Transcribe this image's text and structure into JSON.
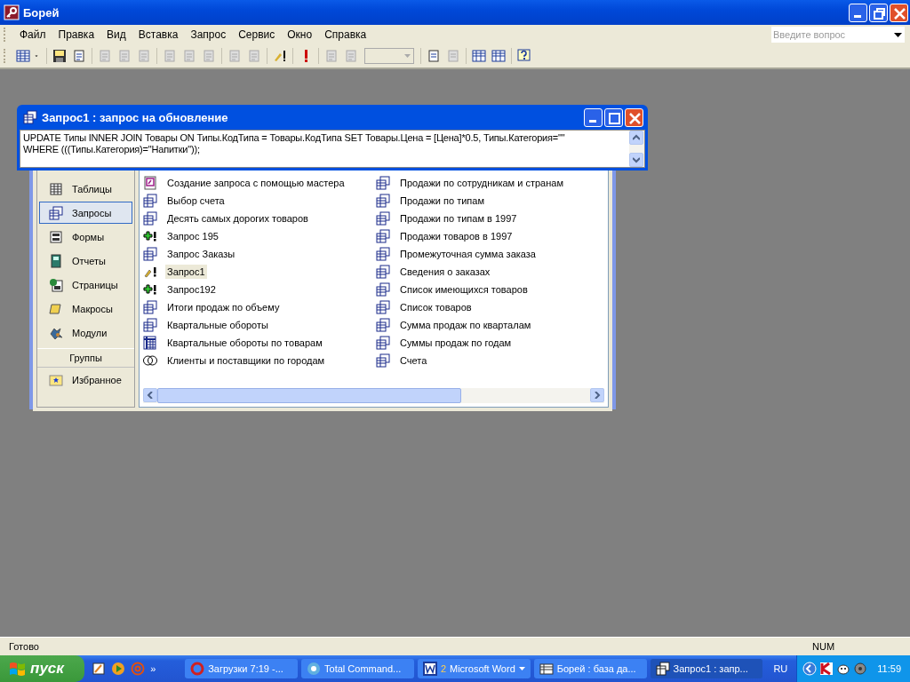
{
  "app": {
    "title": "Борей",
    "menu": [
      "Файл",
      "Правка",
      "Вид",
      "Вставка",
      "Запрос",
      "Сервис",
      "Окно",
      "Справка"
    ],
    "help_placeholder": "Введите вопрос"
  },
  "query_window": {
    "title": "Запрос1 : запрос на обновление",
    "sql": "UPDATE Типы INNER JOIN Товары ON Типы.КодТипа = Товары.КодТипа SET Товары.Цена = [Цена]*0.5, Типы.Категория=\"\" WHERE (((Типы.Категория)=\"Напитки\"));"
  },
  "db_window": {
    "objects": [
      {
        "label": "Таблицы",
        "kind": "table",
        "selected": false
      },
      {
        "label": "Запросы",
        "kind": "query",
        "selected": true
      },
      {
        "label": "Формы",
        "kind": "form",
        "selected": false
      },
      {
        "label": "Отчеты",
        "kind": "report",
        "selected": false
      },
      {
        "label": "Страницы",
        "kind": "page",
        "selected": false
      },
      {
        "label": "Макросы",
        "kind": "macro",
        "selected": false
      },
      {
        "label": "Модули",
        "kind": "module",
        "selected": false
      }
    ],
    "groups_header": "Группы",
    "groups": [
      {
        "label": "Избранное",
        "kind": "favorites",
        "selected": false
      }
    ],
    "items": [
      {
        "label": "Создание запроса с помощью мастера",
        "kind": "wizard",
        "selected": false
      },
      {
        "label": "Выбор счета",
        "kind": "select",
        "selected": false
      },
      {
        "label": "Десять самых дорогих товаров",
        "kind": "select",
        "selected": false
      },
      {
        "label": "Запрос 195",
        "kind": "append",
        "selected": false
      },
      {
        "label": "Запрос Заказы",
        "kind": "select",
        "selected": false
      },
      {
        "label": "Запрос1",
        "kind": "update",
        "selected": true
      },
      {
        "label": "Запрос192",
        "kind": "append",
        "selected": false
      },
      {
        "label": "Итоги продаж по объему",
        "kind": "select",
        "selected": false
      },
      {
        "label": "Квартальные обороты",
        "kind": "select",
        "selected": false
      },
      {
        "label": "Квартальные обороты по товарам",
        "kind": "crosstab",
        "selected": false
      },
      {
        "label": "Клиенты и поставщики по городам",
        "kind": "union",
        "selected": false
      },
      {
        "label": "Продажи по сотрудникам и странам",
        "kind": "select",
        "selected": false
      },
      {
        "label": "Продажи по типам",
        "kind": "select",
        "selected": false
      },
      {
        "label": "Продажи по типам в 1997",
        "kind": "select",
        "selected": false
      },
      {
        "label": "Продажи товаров в 1997",
        "kind": "select",
        "selected": false
      },
      {
        "label": "Промежуточная сумма заказа",
        "kind": "select",
        "selected": false
      },
      {
        "label": "Сведения о заказах",
        "kind": "select",
        "selected": false
      },
      {
        "label": "Список имеющихся товаров",
        "kind": "select",
        "selected": false
      },
      {
        "label": "Список товаров",
        "kind": "select",
        "selected": false
      },
      {
        "label": "Сумма продаж по кварталам",
        "kind": "select",
        "selected": false
      },
      {
        "label": "Суммы продаж по годам",
        "kind": "select",
        "selected": false
      },
      {
        "label": "Счета",
        "kind": "select",
        "selected": false
      }
    ]
  },
  "status_bar": {
    "text": "Готово",
    "num": "NUM"
  },
  "taskbar": {
    "start": "пуск",
    "more": "»",
    "tasks": [
      {
        "label": "Загрузки 7:19 -...",
        "kind": "opera",
        "selected": false
      },
      {
        "label": "Total Command...",
        "kind": "commander",
        "selected": false
      },
      {
        "label": "Microsoft Word",
        "count": "2",
        "kind": "word",
        "selected": false
      },
      {
        "label": "Борей : база да...",
        "kind": "access",
        "selected": false
      },
      {
        "label": "Запрос1 : запр...",
        "kind": "query",
        "selected": true
      }
    ],
    "lang": "RU",
    "time": "11:59"
  }
}
